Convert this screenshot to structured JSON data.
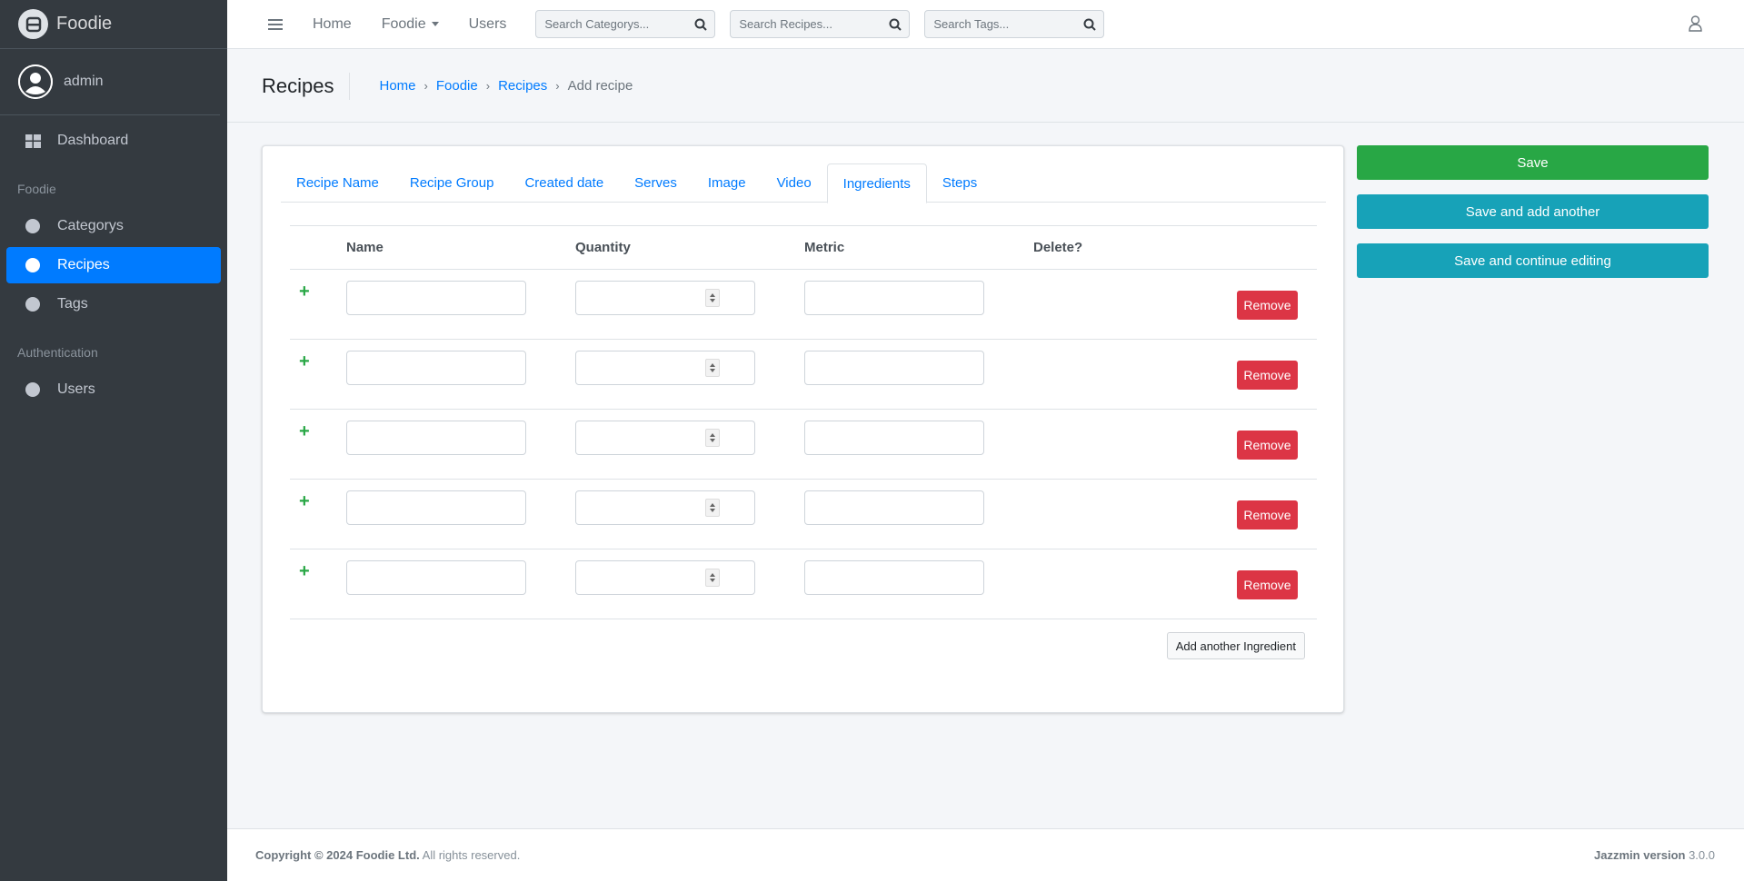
{
  "brand": {
    "name": "Foodie"
  },
  "user": {
    "name": "admin"
  },
  "sidebar": {
    "dashboard": "Dashboard",
    "section_foodie": "Foodie",
    "items_foodie": [
      "Categorys",
      "Recipes",
      "Tags"
    ],
    "section_auth": "Authentication",
    "items_auth": [
      "Users"
    ]
  },
  "topbar": {
    "links": [
      "Home",
      "Foodie",
      "Users"
    ],
    "search_categories": "Search Categorys...",
    "search_recipes": "Search Recipes...",
    "search_tags": "Search Tags..."
  },
  "header": {
    "title": "Recipes",
    "breadcrumb": [
      "Home",
      "Foodie",
      "Recipes",
      "Add recipe"
    ]
  },
  "tabs": [
    "Recipe Name",
    "Recipe Group",
    "Created date",
    "Serves",
    "Image",
    "Video",
    "Ingredients",
    "Steps"
  ],
  "active_tab": "Ingredients",
  "ingredients": {
    "columns": [
      "Name",
      "Quantity",
      "Metric",
      "Delete?"
    ],
    "remove_label": "Remove",
    "add_label": "Add another Ingredient"
  },
  "actions": {
    "save": "Save",
    "save_add": "Save and add another",
    "save_continue": "Save and continue editing"
  },
  "footer": {
    "copyright_bold": "Copyright © 2024 Foodie Ltd.",
    "copyright_rest": " All rights reserved.",
    "version_label": "Jazzmin version",
    "version": " 3.0.0"
  },
  "colors": {
    "primary": "#007bff",
    "success": "#28a745",
    "info": "#17a2b8",
    "danger": "#dc3545",
    "sidebar": "#343a40"
  }
}
